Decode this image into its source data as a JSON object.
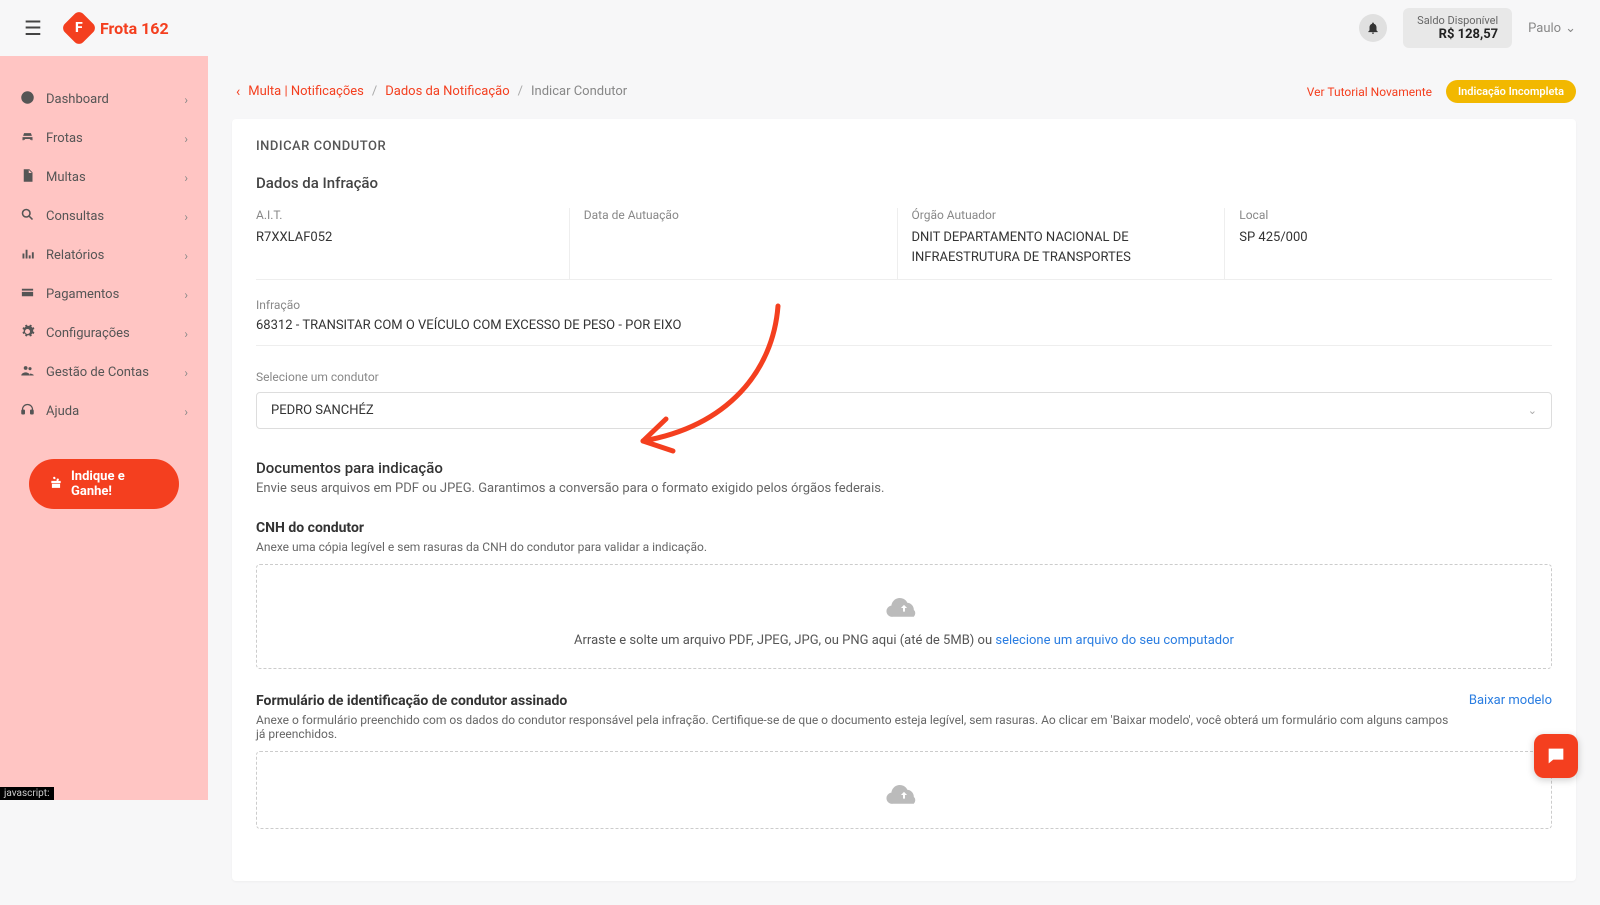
{
  "logo": {
    "mark": "F",
    "text": "Frota 162"
  },
  "topbar": {
    "balance_label": "Saldo Disponível",
    "balance_value": "R$ 128,57",
    "user_name": "Paulo"
  },
  "sidebar": {
    "items": [
      {
        "label": "Dashboard"
      },
      {
        "label": "Frotas"
      },
      {
        "label": "Multas"
      },
      {
        "label": "Consultas"
      },
      {
        "label": "Relatórios"
      },
      {
        "label": "Pagamentos"
      },
      {
        "label": "Configurações"
      },
      {
        "label": "Gestão de Contas"
      },
      {
        "label": "Ajuda"
      }
    ],
    "cta": "Indique e Ganhe!"
  },
  "breadcrumbs": {
    "crumb1": "Multa | Notificações",
    "crumb2": "Dados da Notificação",
    "current": "Indicar Condutor",
    "tutorial": "Ver Tutorial Novamente",
    "status": "Indicação Incompleta"
  },
  "card_title": "INDICAR CONDUTOR",
  "infraction": {
    "heading": "Dados da Infração",
    "ait_label": "A.I.T.",
    "ait_value": "R7XXLAF052",
    "date_label": "Data de Autuação",
    "date_value": "",
    "orgao_label": "Órgão Autuador",
    "orgao_value": "DNIT DEPARTAMENTO NACIONAL DE INFRAESTRUTURA DE TRANSPORTES",
    "local_label": "Local",
    "local_value": "SP 425/000",
    "infracao_label": "Infração",
    "infracao_value": "68312 - TRANSITAR COM O VEÍCULO COM EXCESSO DE PESO - POR EIXO"
  },
  "driver_select": {
    "label": "Selecione um condutor",
    "value": "PEDRO SANCHÉZ"
  },
  "docs": {
    "heading": "Documentos para indicação",
    "sub": "Envie seus arquivos em PDF ou JPEG. Garantimos a conversão para o formato exigido pelos órgãos federais.",
    "cnh_heading": "CNH do condutor",
    "cnh_sub": "Anexe uma cópia legível e sem rasuras da CNH do condutor para validar a indicação.",
    "drop_text": "Arraste e solte um arquivo PDF, JPEG, JPG, ou PNG aqui (até de 5MB) ou ",
    "drop_link": "selecione um arquivo do seu computador",
    "form_heading": "Formulário de identificação de condutor assinado",
    "form_sub": "Anexe o formulário preenchido com os dados do condutor responsável pela infração. Certifique-se de que o documento esteja legível, sem rasuras. Ao clicar em 'Baixar modelo', você obterá um formulário com alguns campos já preenchidos.",
    "download_model": "Baixar modelo"
  },
  "footer_js": "javascript:"
}
